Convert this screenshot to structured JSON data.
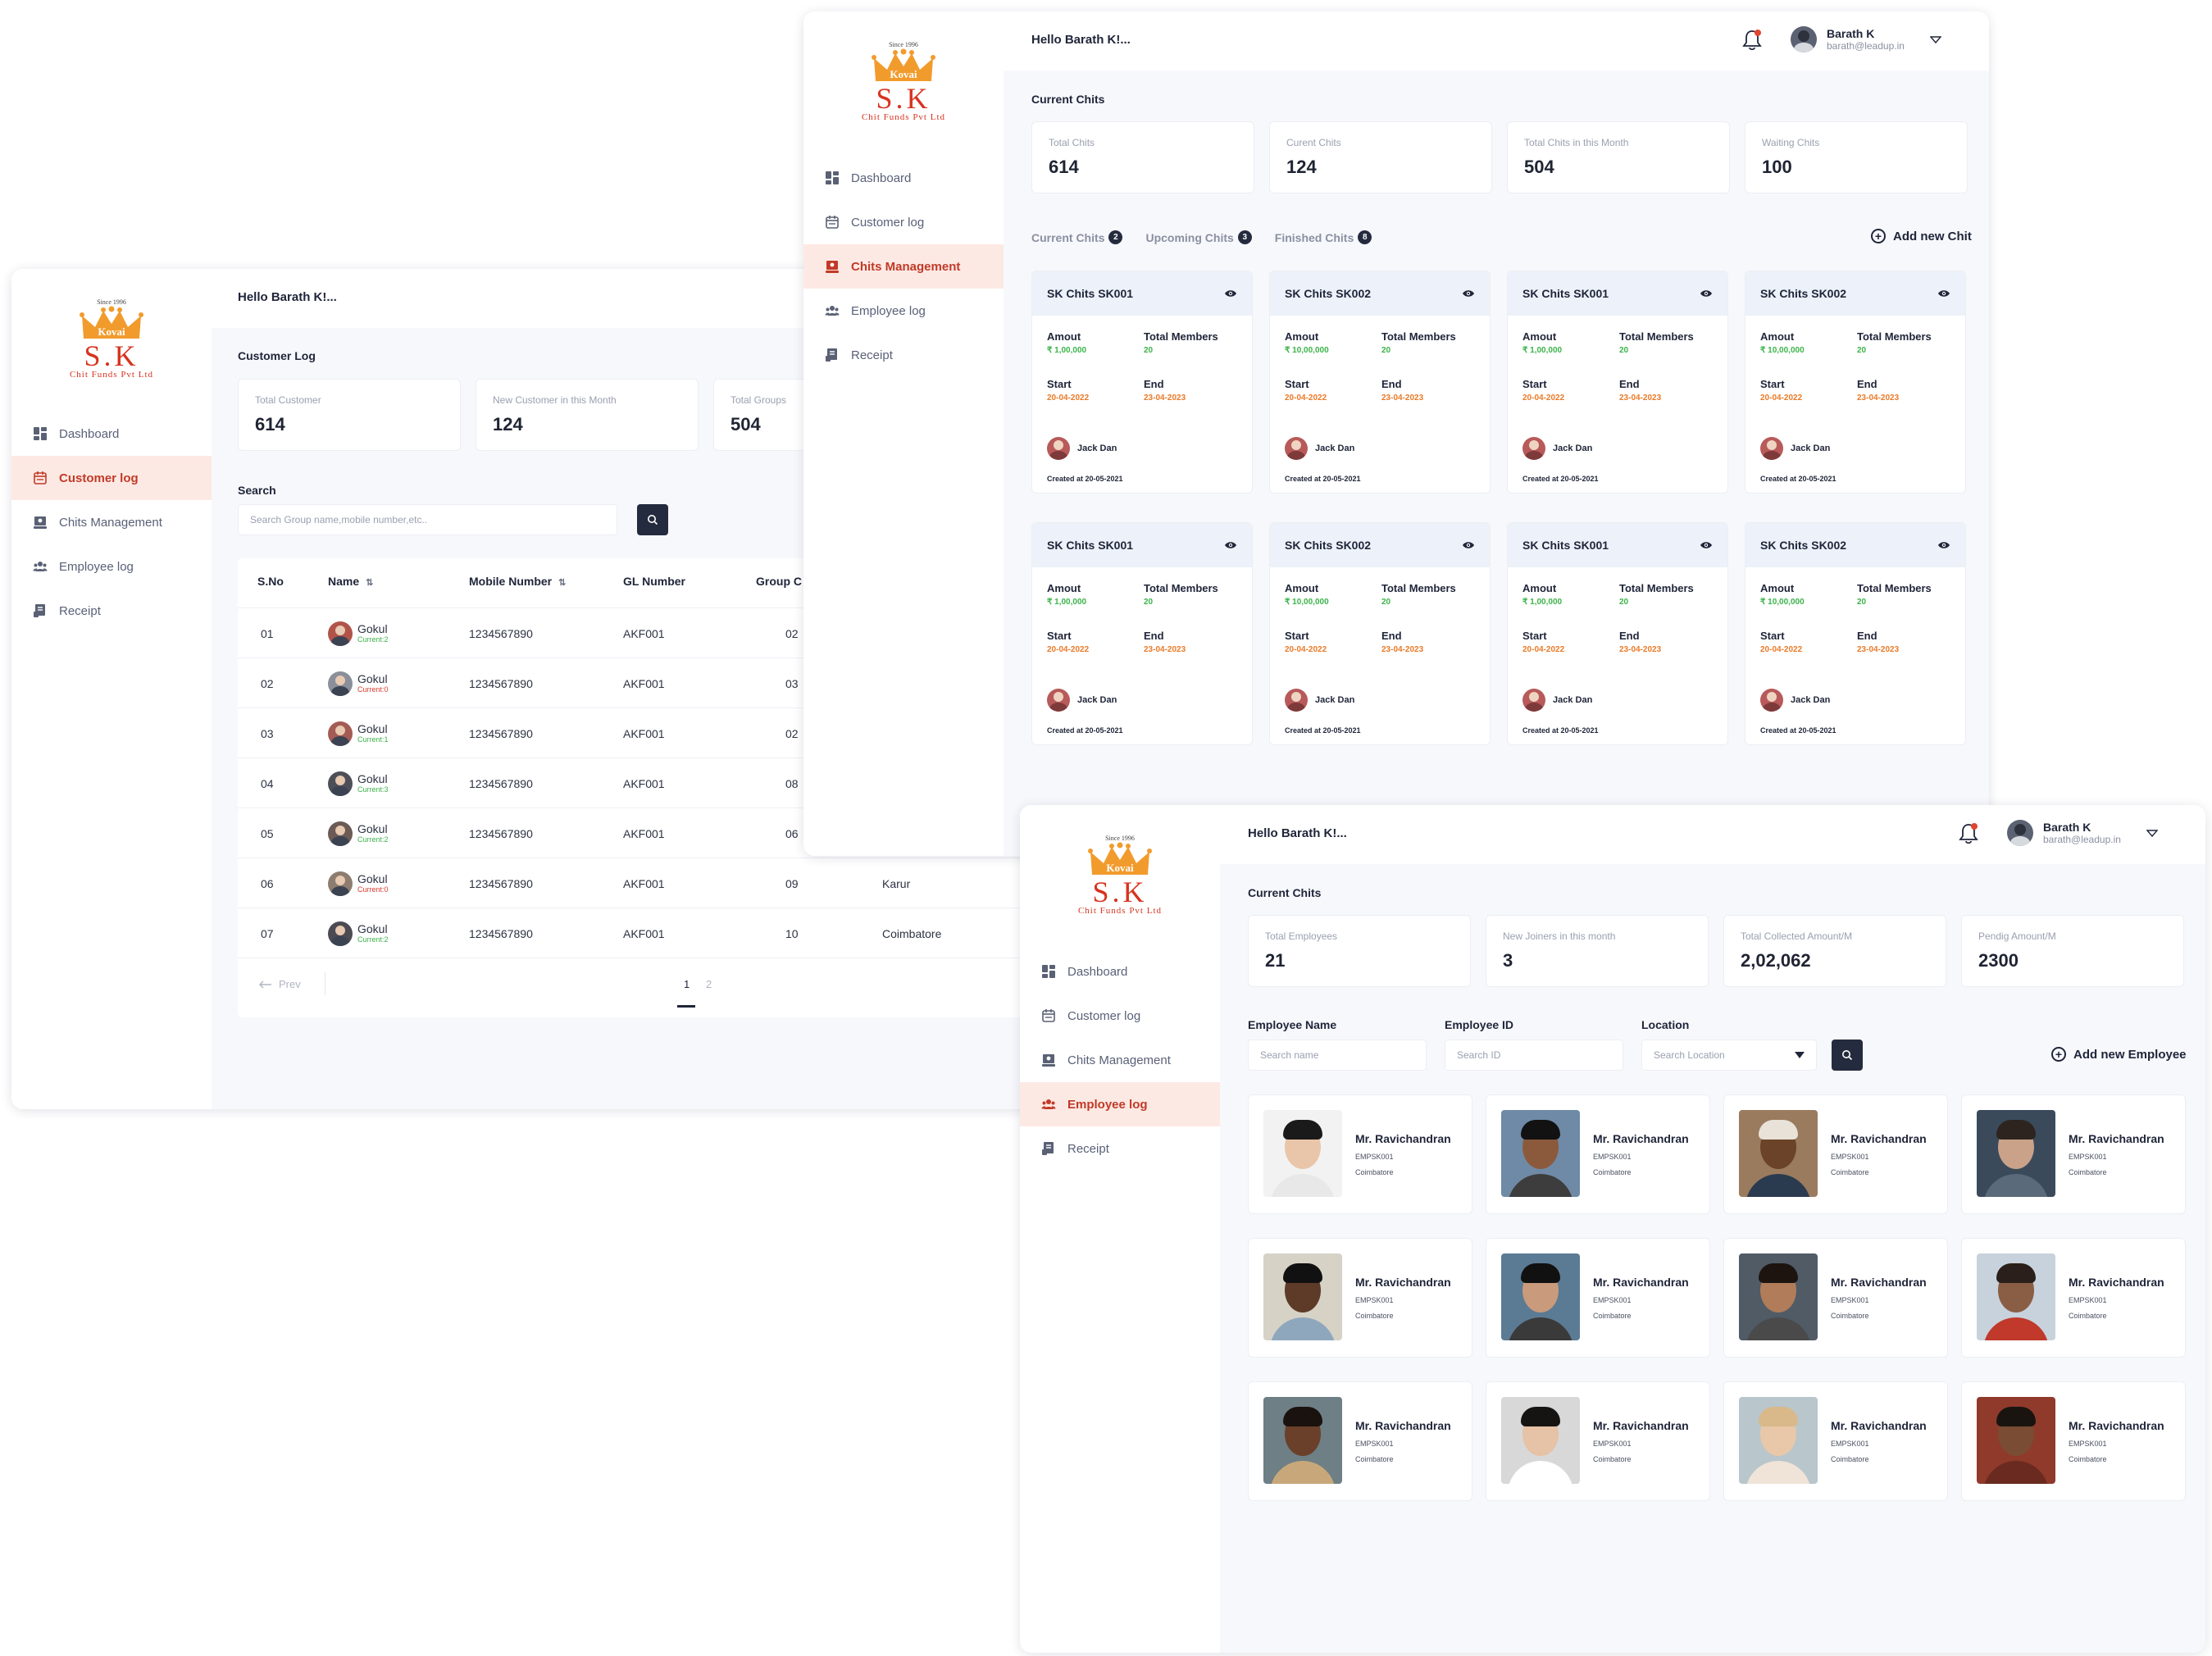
{
  "brand": {
    "since": "Since 1996",
    "crown_text": "Kovai",
    "initials": "S.K",
    "company": "Chit Funds Pvt Ltd",
    "accent": "#c13a27",
    "crown_color": "#f29b2d"
  },
  "nav": [
    {
      "label": "Dashboard",
      "icon": "dashboard-icon"
    },
    {
      "label": "Customer log",
      "icon": "customer-log-icon"
    },
    {
      "label": "Chits Management",
      "icon": "chits-icon"
    },
    {
      "label": "Employee log",
      "icon": "employee-icon"
    },
    {
      "label": "Receipt",
      "icon": "receipt-icon"
    }
  ],
  "greeting": "Hello Barath K!...",
  "user": {
    "name": "Barath K",
    "email": "barath@leadup.in"
  },
  "customer": {
    "section_title": "Customer Log",
    "stats": [
      {
        "label": "Total Customer",
        "value": "614"
      },
      {
        "label": "New Customer in this Month",
        "value": "124"
      },
      {
        "label": "Total Groups",
        "value": "504"
      }
    ],
    "search_label": "Search",
    "search_placeholder": "Search Group name,mobile number,etc..",
    "columns": [
      "S.No",
      "Name",
      "Mobile Number",
      "GL Number",
      "Group C"
    ],
    "rows": [
      {
        "sno": "01",
        "name": "Gokul",
        "status": "Current:2",
        "status_color": "green",
        "mobile": "1234567890",
        "gl": "AKF001",
        "group": "02",
        "location": ""
      },
      {
        "sno": "02",
        "name": "Gokul",
        "status": "Current:0",
        "status_color": "red",
        "mobile": "1234567890",
        "gl": "AKF001",
        "group": "03",
        "location": ""
      },
      {
        "sno": "03",
        "name": "Gokul",
        "status": "Current:1",
        "status_color": "green",
        "mobile": "1234567890",
        "gl": "AKF001",
        "group": "02",
        "location": ""
      },
      {
        "sno": "04",
        "name": "Gokul",
        "status": "Current:3",
        "status_color": "green",
        "mobile": "1234567890",
        "gl": "AKF001",
        "group": "08",
        "location": ""
      },
      {
        "sno": "05",
        "name": "Gokul",
        "status": "Current:2",
        "status_color": "green",
        "mobile": "1234567890",
        "gl": "AKF001",
        "group": "06",
        "location": ""
      },
      {
        "sno": "06",
        "name": "Gokul",
        "status": "Current:0",
        "status_color": "red",
        "mobile": "1234567890",
        "gl": "AKF001",
        "group": "09",
        "location": "Karur"
      },
      {
        "sno": "07",
        "name": "Gokul",
        "status": "Current:2",
        "status_color": "green",
        "mobile": "1234567890",
        "gl": "AKF001",
        "group": "10",
        "location": "Coimbatore"
      }
    ],
    "pager": {
      "prev": "Prev",
      "pages": [
        "1",
        "2"
      ],
      "current": "1"
    }
  },
  "chits": {
    "section_title": "Current Chits",
    "stats": [
      {
        "label": "Total Chits",
        "value": "614"
      },
      {
        "label": "Curent Chits",
        "value": "124"
      },
      {
        "label": "Total Chits in this Month",
        "value": "504"
      },
      {
        "label": "Waiting Chits",
        "value": "100"
      }
    ],
    "tabs": [
      {
        "label": "Current Chits",
        "count": "2"
      },
      {
        "label": "Upcoming Chits",
        "count": "3"
      },
      {
        "label": "Finished Chits",
        "count": "8"
      }
    ],
    "add_label": "Add new Chit",
    "cards": [
      {
        "title": "SK Chits SK001",
        "amount": "₹ 1,00,000",
        "members": "20",
        "start": "20-04-2022",
        "end": "23-04-2023",
        "owner": "Jack Dan",
        "created": "Created at 20-05-2021"
      },
      {
        "title": "SK Chits SK002",
        "amount": "₹ 10,00,000",
        "members": "20",
        "start": "20-04-2022",
        "end": "23-04-2023",
        "owner": "Jack Dan",
        "created": "Created at 20-05-2021"
      },
      {
        "title": "SK Chits SK001",
        "amount": "₹ 1,00,000",
        "members": "20",
        "start": "20-04-2022",
        "end": "23-04-2023",
        "owner": "Jack Dan",
        "created": "Created at 20-05-2021"
      },
      {
        "title": "SK Chits SK002",
        "amount": "₹ 10,00,000",
        "members": "20",
        "start": "20-04-2022",
        "end": "23-04-2023",
        "owner": "Jack Dan",
        "created": "Created at 20-05-2021"
      },
      {
        "title": "SK Chits SK001",
        "amount": "₹ 1,00,000",
        "members": "20",
        "start": "20-04-2022",
        "end": "23-04-2023",
        "owner": "Jack Dan",
        "created": "Created at 20-05-2021"
      },
      {
        "title": "SK Chits SK002",
        "amount": "₹ 10,00,000",
        "members": "20",
        "start": "20-04-2022",
        "end": "23-04-2023",
        "owner": "Jack Dan",
        "created": "Created at 20-05-2021"
      },
      {
        "title": "SK Chits SK001",
        "amount": "₹ 1,00,000",
        "members": "20",
        "start": "20-04-2022",
        "end": "23-04-2023",
        "owner": "Jack Dan",
        "created": "Created at 20-05-2021"
      },
      {
        "title": "SK Chits SK002",
        "amount": "₹ 10,00,000",
        "members": "20",
        "start": "20-04-2022",
        "end": "23-04-2023",
        "owner": "Jack Dan",
        "created": "Created at 20-05-2021"
      }
    ],
    "labels": {
      "amount": "Amout",
      "members": "Total Members",
      "start": "Start",
      "end": "End"
    }
  },
  "employees": {
    "section_title": "Current Chits",
    "stats": [
      {
        "label": "Total  Employees",
        "value": "21"
      },
      {
        "label": "New Joiners in this month",
        "value": "3"
      },
      {
        "label": "Total Collected Amount/M",
        "value": "2,02,062"
      },
      {
        "label": "Pendig Amount/M",
        "value": "2300"
      }
    ],
    "filters": [
      {
        "label": "Employee Name",
        "placeholder": "Search name"
      },
      {
        "label": "Employee ID",
        "placeholder": "Search ID"
      },
      {
        "label": "Location",
        "placeholder": "Search Location"
      }
    ],
    "add_label": "Add new Employee",
    "cards": [
      {
        "name": "Mr. Ravichandran",
        "id": "EMPSK001",
        "location": "Coimbatore"
      },
      {
        "name": "Mr. Ravichandran",
        "id": "EMPSK001",
        "location": "Coimbatore"
      },
      {
        "name": "Mr. Ravichandran",
        "id": "EMPSK001",
        "location": "Coimbatore"
      },
      {
        "name": "Mr. Ravichandran",
        "id": "EMPSK001",
        "location": "Coimbatore"
      },
      {
        "name": "Mr. Ravichandran",
        "id": "EMPSK001",
        "location": "Coimbatore"
      },
      {
        "name": "Mr. Ravichandran",
        "id": "EMPSK001",
        "location": "Coimbatore"
      },
      {
        "name": "Mr. Ravichandran",
        "id": "EMPSK001",
        "location": "Coimbatore"
      },
      {
        "name": "Mr. Ravichandran",
        "id": "EMPSK001",
        "location": "Coimbatore"
      },
      {
        "name": "Mr. Ravichandran",
        "id": "EMPSK001",
        "location": "Coimbatore"
      },
      {
        "name": "Mr. Ravichandran",
        "id": "EMPSK001",
        "location": "Coimbatore"
      },
      {
        "name": "Mr. Ravichandran",
        "id": "EMPSK001",
        "location": "Coimbatore"
      },
      {
        "name": "Mr. Ravichandran",
        "id": "EMPSK001",
        "location": "Coimbatore"
      }
    ]
  }
}
